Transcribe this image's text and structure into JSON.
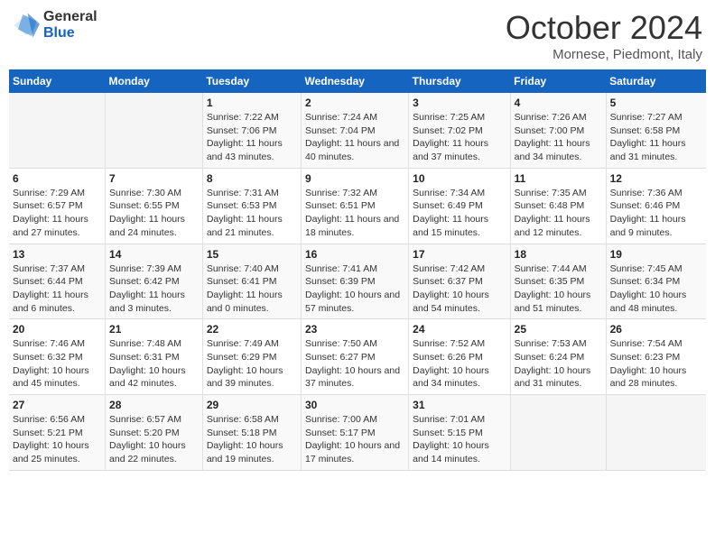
{
  "header": {
    "logo_general": "General",
    "logo_blue": "Blue",
    "month_title": "October 2024",
    "location": "Mornese, Piedmont, Italy"
  },
  "days_of_week": [
    "Sunday",
    "Monday",
    "Tuesday",
    "Wednesday",
    "Thursday",
    "Friday",
    "Saturday"
  ],
  "weeks": [
    [
      {
        "day": "",
        "info": ""
      },
      {
        "day": "",
        "info": ""
      },
      {
        "day": "1",
        "info": "Sunrise: 7:22 AM\nSunset: 7:06 PM\nDaylight: 11 hours and 43 minutes."
      },
      {
        "day": "2",
        "info": "Sunrise: 7:24 AM\nSunset: 7:04 PM\nDaylight: 11 hours and 40 minutes."
      },
      {
        "day": "3",
        "info": "Sunrise: 7:25 AM\nSunset: 7:02 PM\nDaylight: 11 hours and 37 minutes."
      },
      {
        "day": "4",
        "info": "Sunrise: 7:26 AM\nSunset: 7:00 PM\nDaylight: 11 hours and 34 minutes."
      },
      {
        "day": "5",
        "info": "Sunrise: 7:27 AM\nSunset: 6:58 PM\nDaylight: 11 hours and 31 minutes."
      }
    ],
    [
      {
        "day": "6",
        "info": "Sunrise: 7:29 AM\nSunset: 6:57 PM\nDaylight: 11 hours and 27 minutes."
      },
      {
        "day": "7",
        "info": "Sunrise: 7:30 AM\nSunset: 6:55 PM\nDaylight: 11 hours and 24 minutes."
      },
      {
        "day": "8",
        "info": "Sunrise: 7:31 AM\nSunset: 6:53 PM\nDaylight: 11 hours and 21 minutes."
      },
      {
        "day": "9",
        "info": "Sunrise: 7:32 AM\nSunset: 6:51 PM\nDaylight: 11 hours and 18 minutes."
      },
      {
        "day": "10",
        "info": "Sunrise: 7:34 AM\nSunset: 6:49 PM\nDaylight: 11 hours and 15 minutes."
      },
      {
        "day": "11",
        "info": "Sunrise: 7:35 AM\nSunset: 6:48 PM\nDaylight: 11 hours and 12 minutes."
      },
      {
        "day": "12",
        "info": "Sunrise: 7:36 AM\nSunset: 6:46 PM\nDaylight: 11 hours and 9 minutes."
      }
    ],
    [
      {
        "day": "13",
        "info": "Sunrise: 7:37 AM\nSunset: 6:44 PM\nDaylight: 11 hours and 6 minutes."
      },
      {
        "day": "14",
        "info": "Sunrise: 7:39 AM\nSunset: 6:42 PM\nDaylight: 11 hours and 3 minutes."
      },
      {
        "day": "15",
        "info": "Sunrise: 7:40 AM\nSunset: 6:41 PM\nDaylight: 11 hours and 0 minutes."
      },
      {
        "day": "16",
        "info": "Sunrise: 7:41 AM\nSunset: 6:39 PM\nDaylight: 10 hours and 57 minutes."
      },
      {
        "day": "17",
        "info": "Sunrise: 7:42 AM\nSunset: 6:37 PM\nDaylight: 10 hours and 54 minutes."
      },
      {
        "day": "18",
        "info": "Sunrise: 7:44 AM\nSunset: 6:35 PM\nDaylight: 10 hours and 51 minutes."
      },
      {
        "day": "19",
        "info": "Sunrise: 7:45 AM\nSunset: 6:34 PM\nDaylight: 10 hours and 48 minutes."
      }
    ],
    [
      {
        "day": "20",
        "info": "Sunrise: 7:46 AM\nSunset: 6:32 PM\nDaylight: 10 hours and 45 minutes."
      },
      {
        "day": "21",
        "info": "Sunrise: 7:48 AM\nSunset: 6:31 PM\nDaylight: 10 hours and 42 minutes."
      },
      {
        "day": "22",
        "info": "Sunrise: 7:49 AM\nSunset: 6:29 PM\nDaylight: 10 hours and 39 minutes."
      },
      {
        "day": "23",
        "info": "Sunrise: 7:50 AM\nSunset: 6:27 PM\nDaylight: 10 hours and 37 minutes."
      },
      {
        "day": "24",
        "info": "Sunrise: 7:52 AM\nSunset: 6:26 PM\nDaylight: 10 hours and 34 minutes."
      },
      {
        "day": "25",
        "info": "Sunrise: 7:53 AM\nSunset: 6:24 PM\nDaylight: 10 hours and 31 minutes."
      },
      {
        "day": "26",
        "info": "Sunrise: 7:54 AM\nSunset: 6:23 PM\nDaylight: 10 hours and 28 minutes."
      }
    ],
    [
      {
        "day": "27",
        "info": "Sunrise: 6:56 AM\nSunset: 5:21 PM\nDaylight: 10 hours and 25 minutes."
      },
      {
        "day": "28",
        "info": "Sunrise: 6:57 AM\nSunset: 5:20 PM\nDaylight: 10 hours and 22 minutes."
      },
      {
        "day": "29",
        "info": "Sunrise: 6:58 AM\nSunset: 5:18 PM\nDaylight: 10 hours and 19 minutes."
      },
      {
        "day": "30",
        "info": "Sunrise: 7:00 AM\nSunset: 5:17 PM\nDaylight: 10 hours and 17 minutes."
      },
      {
        "day": "31",
        "info": "Sunrise: 7:01 AM\nSunset: 5:15 PM\nDaylight: 10 hours and 14 minutes."
      },
      {
        "day": "",
        "info": ""
      },
      {
        "day": "",
        "info": ""
      }
    ]
  ]
}
